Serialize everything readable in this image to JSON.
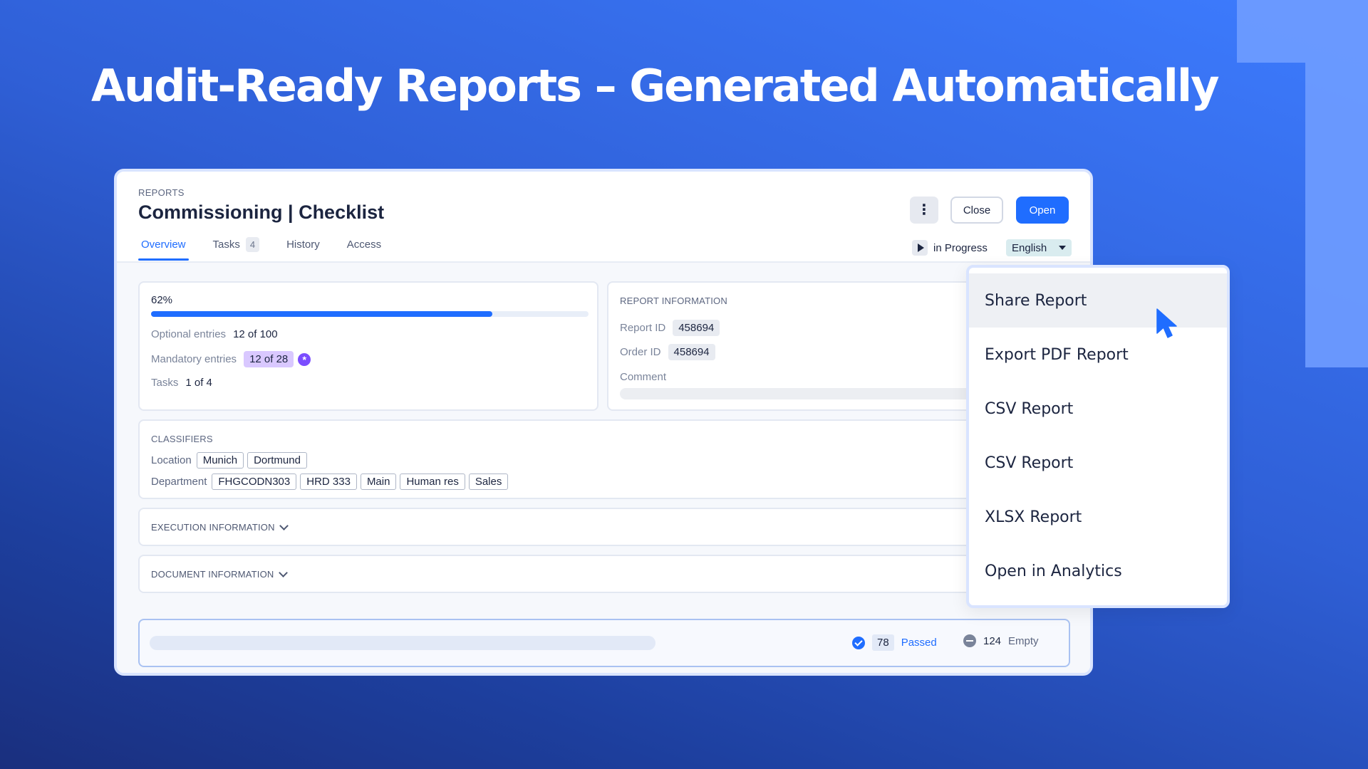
{
  "headline": "Audit-Ready Reports – Generated Automatically",
  "header": {
    "eyebrow": "REPORTS",
    "title": "Commissioning | Checklist",
    "more_icon": "⋮",
    "close_label": "Close",
    "open_label": "Open"
  },
  "tabs": [
    {
      "label": "Overview",
      "active": true
    },
    {
      "label": "Tasks",
      "count": "4"
    },
    {
      "label": "History"
    },
    {
      "label": "Access"
    }
  ],
  "status": {
    "label": "in Progress",
    "icon": "play-icon"
  },
  "language": {
    "selected": "English"
  },
  "progress": {
    "percent_label": "62%",
    "fill_fraction": 0.78,
    "optional": {
      "label": "Optional entries",
      "value": "12 of 100"
    },
    "mandatory": {
      "label": "Mandatory entries",
      "value": "12 of 28"
    },
    "tasks": {
      "label": "Tasks",
      "value": "1 of 4"
    }
  },
  "report_info": {
    "heading": "REPORT INFORMATION",
    "report_id": {
      "label": "Report ID",
      "value": "458694"
    },
    "order_id": {
      "label": "Order ID",
      "value": "458694"
    },
    "comment_label": "Comment"
  },
  "classifiers": {
    "heading": "CLASSIFIERS",
    "location": {
      "label": "Location",
      "chips": [
        "Munich",
        "Dortmund"
      ]
    },
    "department": {
      "label": "Department",
      "chips": [
        "FHGCODN303",
        "HRD 333",
        "Main",
        "Human res",
        "Sales"
      ]
    }
  },
  "execution": {
    "heading": "EXECUTION INFORMATION"
  },
  "document": {
    "heading": "DOCUMENT INFORMATION"
  },
  "footer": {
    "passed": {
      "count": "78",
      "label": "Passed"
    },
    "empty": {
      "count": "124",
      "label": "Empty"
    }
  },
  "menu": {
    "items": [
      "Share Report",
      "Export PDF Report",
      "CSV Report",
      "CSV Report",
      "XLSX Report",
      "Open in Analytics"
    ],
    "hovered_index": 0
  },
  "colors": {
    "accent": "#1f6dff",
    "purple_badge": "#d9c8ff",
    "background_top": "#3d7cff",
    "background_bottom": "#1a2f7e"
  }
}
